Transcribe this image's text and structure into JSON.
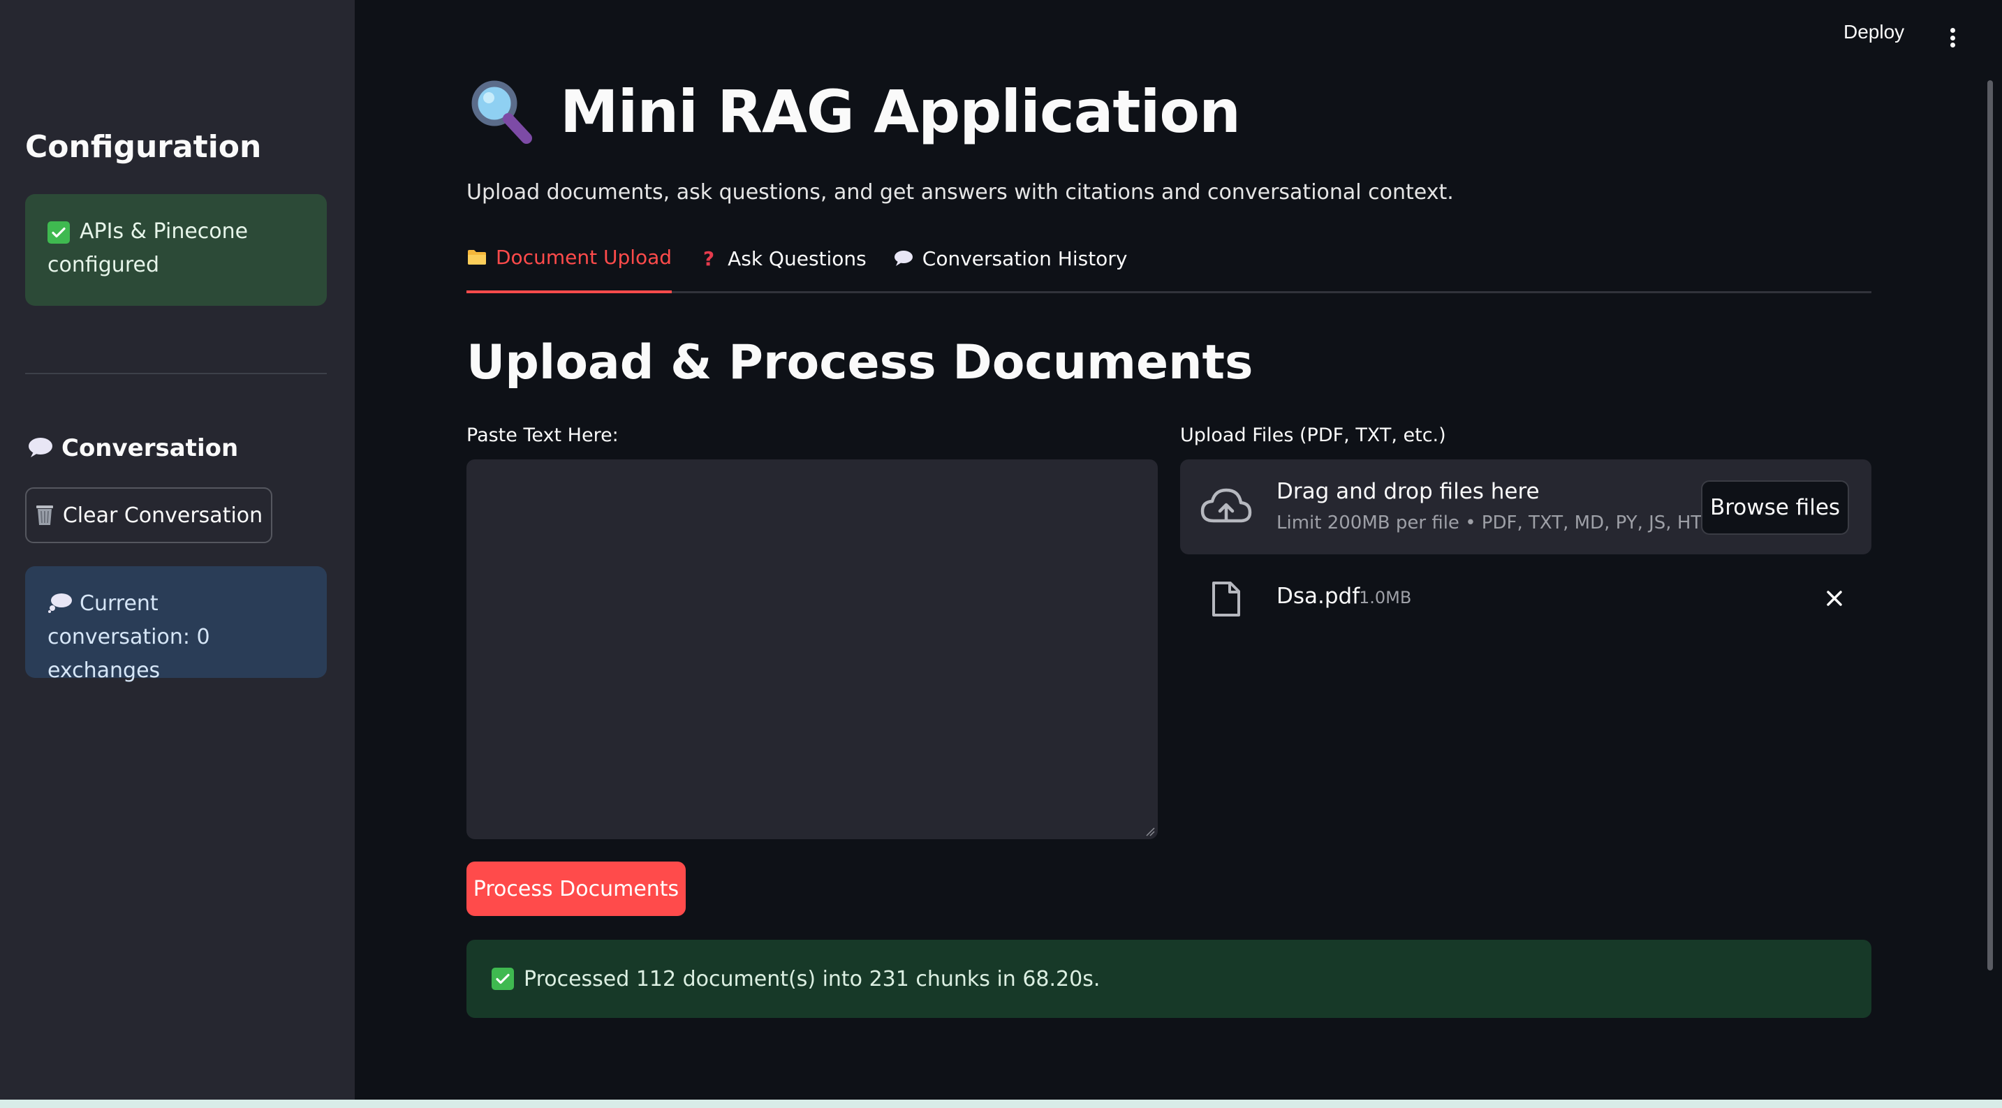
{
  "header": {
    "deploy_label": "Deploy",
    "menu_icon": "vertical-dots-icon"
  },
  "sidebar": {
    "title": "Configuration",
    "status_message": "APIs & Pinecone configured",
    "conversation_heading": "Conversation",
    "clear_button_label": "Clear Conversation",
    "conversation_info": "Current conversation: 0 exchanges",
    "icons": [
      "check-icon",
      "speech-bubble-icon",
      "wastebasket-icon",
      "thought-bubble-icon"
    ]
  },
  "main": {
    "title": "Mini RAG Application",
    "subtitle": "Upload documents, ask questions, and get answers with citations and conversational context.",
    "tabs": [
      {
        "label": "Document Upload",
        "icon": "folder-icon",
        "active": true
      },
      {
        "label": "Ask Questions",
        "icon": "question-icon",
        "active": false
      },
      {
        "label": "Conversation History",
        "icon": "speech-bubble-icon",
        "active": false
      }
    ],
    "section_title": "Upload & Process Documents",
    "paste_label": "Paste Text Here:",
    "paste_value": "",
    "upload_label": "Upload Files (PDF, TXT, etc.)",
    "dropzone_title": "Drag and drop files here",
    "dropzone_subtitle": "Limit 200MB per file • PDF, TXT, MD, PY, JS, HTM…",
    "browse_button": "Browse files",
    "uploaded_file": {
      "name": "Dsa.pdf",
      "size": "1.0MB"
    },
    "process_button": "Process Documents",
    "result_message": "Processed 112 document(s) into 231 chunks in 68.20s."
  },
  "colors": {
    "background": "#0e1117",
    "sidebar": "#262730",
    "accent": "#ff4b4b",
    "success_bg": "#173928",
    "info_bg": "#2a3d57"
  }
}
